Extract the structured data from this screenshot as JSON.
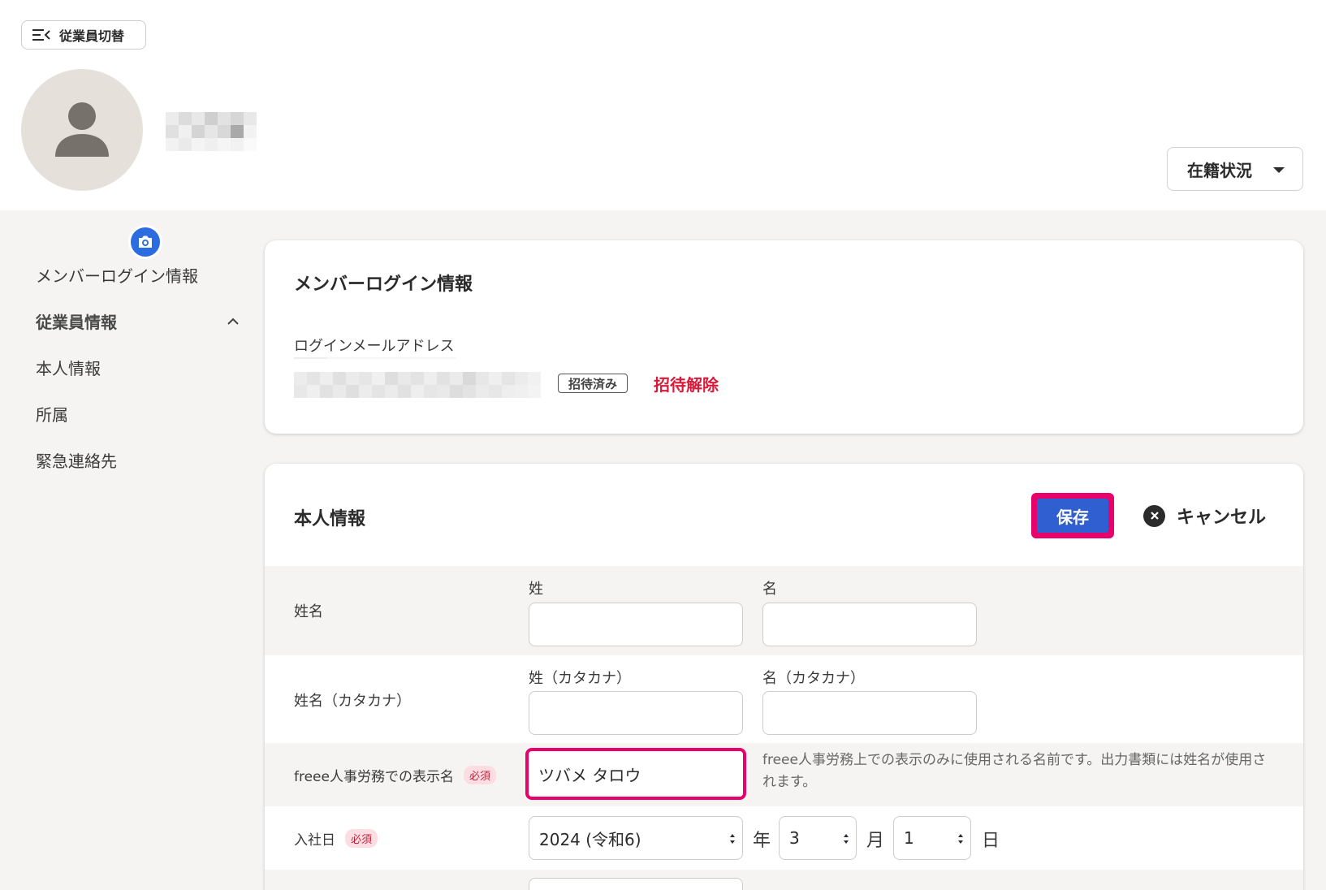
{
  "header": {
    "switch_label": "従業員切替",
    "status_label": "在籍状況"
  },
  "sidebar": {
    "items": [
      {
        "label": "メンバーログイン情報"
      },
      {
        "label": "従業員情報"
      },
      {
        "label": "本人情報"
      },
      {
        "label": "所属"
      },
      {
        "label": "緊急連絡先"
      }
    ]
  },
  "login_card": {
    "title": "メンバーログイン情報",
    "email_label": "ログインメールアドレス",
    "status_badge": "招待済み",
    "uninvite_label": "招待解除"
  },
  "personal_card": {
    "title": "本人情報",
    "save_label": "保存",
    "cancel_label": "キャンセル",
    "name": {
      "label": "姓名",
      "last_label": "姓",
      "first_label": "名",
      "last_value": "",
      "first_value": ""
    },
    "kana": {
      "label": "姓名（カタカナ）",
      "last_label": "姓（カタカナ）",
      "first_label": "名（カタカナ）",
      "last_value": "",
      "first_value": ""
    },
    "display_name": {
      "label": "freee人事労務での表示名",
      "required": "必須",
      "value": "ツバメ タロウ",
      "hint": "freee人事労務上での表示のみに使用される名前です。出力書類には姓名が使用されます。"
    },
    "hire_date": {
      "label": "入社日",
      "required": "必須",
      "year_value": "2024 (令和6)",
      "year_unit": "年",
      "month_value": "3",
      "month_unit": "月",
      "day_value": "1",
      "day_unit": "日"
    }
  }
}
